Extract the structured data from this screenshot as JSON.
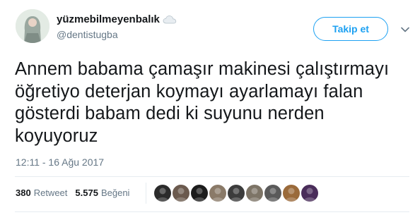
{
  "user": {
    "display_name": "yüzmebilmeyenbalık",
    "handle": "@dentistugba",
    "avatar_icon": "profile-photo",
    "name_emoji_icon": "cloud-icon"
  },
  "follow_button": {
    "label": "Takip et"
  },
  "menu_icon": "chevron-down-icon",
  "tweet": {
    "text": "Annem babama çamaşır makinesi çalıştırmayı\nöğretiyo deterjan koymayı ayarlamayı falan\ngösterdi babam dedi ki suyunu nerden\nkoyuyoruz",
    "timestamp": "12:11 - 16 Ağu 2017"
  },
  "stats": {
    "retweets": {
      "count": "380",
      "label": "Retweet"
    },
    "likes": {
      "count": "5.575",
      "label": "Beğeni"
    }
  },
  "likers": [
    {
      "name": "liker-1",
      "color": "#2b2b2b"
    },
    {
      "name": "liker-2",
      "color": "#6b5a4e"
    },
    {
      "name": "liker-3",
      "color": "#1c1c1c"
    },
    {
      "name": "liker-4",
      "color": "#8a7a68"
    },
    {
      "name": "liker-5",
      "color": "#3c3c3c"
    },
    {
      "name": "liker-6",
      "color": "#7d7466"
    },
    {
      "name": "liker-7",
      "color": "#5a5a5a"
    },
    {
      "name": "liker-8",
      "color": "#9a6a3a"
    },
    {
      "name": "liker-9",
      "color": "#4a2d5a"
    }
  ]
}
